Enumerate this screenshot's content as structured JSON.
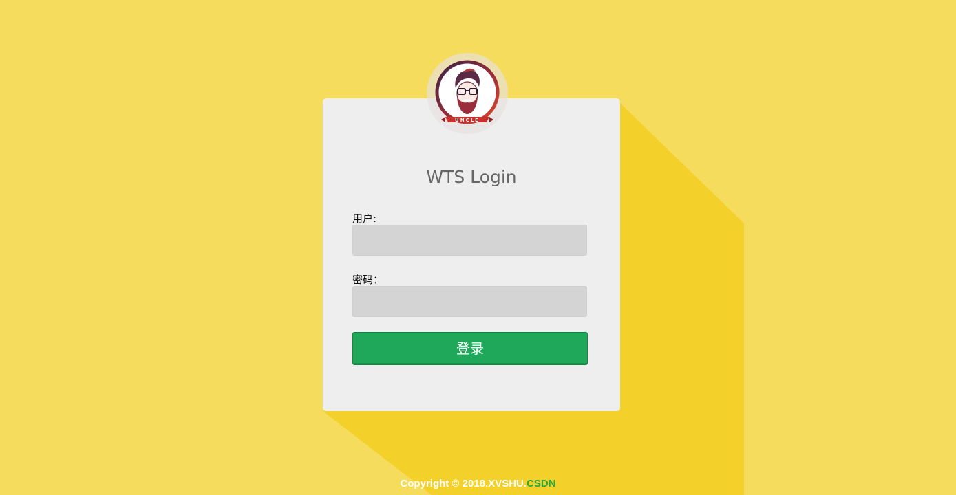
{
  "colors": {
    "background": "#f6dc5c",
    "long_shadow": "#f3d12a",
    "card": "#eeeeee",
    "input": "#d4d4d4",
    "button": "#1fa85a",
    "footer_brand": "#26a843"
  },
  "avatar": {
    "icon": "uncle-avatar-icon",
    "badge_text": "UNCLE"
  },
  "login": {
    "title": "WTS Login",
    "username_label": "用户:",
    "username_value": "",
    "password_label": "密码：",
    "password_value": "",
    "submit_label": "登录"
  },
  "footer": {
    "copyright_text": "Copyright © 2018.XVSHU.",
    "brand": "CSDN"
  }
}
